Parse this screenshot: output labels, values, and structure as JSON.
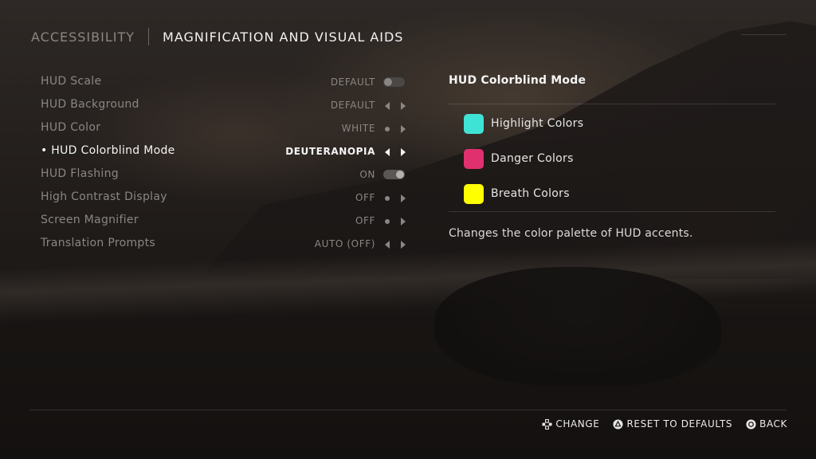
{
  "header": {
    "breadcrumb_parent": "ACCESSIBILITY",
    "title": "MAGNIFICATION AND VISUAL AIDS"
  },
  "settings": [
    {
      "label": "HUD Scale",
      "value": "DEFAULT",
      "control": "toggle",
      "state": "off"
    },
    {
      "label": "HUD Background",
      "value": "DEFAULT",
      "control": "arrows"
    },
    {
      "label": "HUD Color",
      "value": "WHITE",
      "control": "dot-arrow"
    },
    {
      "label": "• HUD Colorblind Mode",
      "value": "DEUTERANOPIA",
      "control": "arrows",
      "selected": true
    },
    {
      "label": "HUD Flashing",
      "value": "ON",
      "control": "toggle",
      "state": "on"
    },
    {
      "label": "High Contrast Display",
      "value": "OFF",
      "control": "dot-arrow"
    },
    {
      "label": "Screen Magnifier",
      "value": "OFF",
      "control": "dot-arrow"
    },
    {
      "label": "Translation Prompts",
      "value": "AUTO (OFF)",
      "control": "arrows"
    }
  ],
  "panel": {
    "title": "HUD Colorblind Mode",
    "swatches": [
      {
        "label": "Highlight Colors",
        "color": "#3fe3d6"
      },
      {
        "label": "Danger Colors",
        "color": "#e0306e"
      },
      {
        "label": "Breath Colors",
        "color": "#ffff00"
      }
    ],
    "description": "Changes the color palette of HUD accents."
  },
  "footer": {
    "change_label": "CHANGE",
    "reset_label": "RESET TO DEFAULTS",
    "back_label": "BACK",
    "icons": [
      "dpad-icon",
      "triangle-button-icon",
      "circle-button-icon"
    ]
  }
}
